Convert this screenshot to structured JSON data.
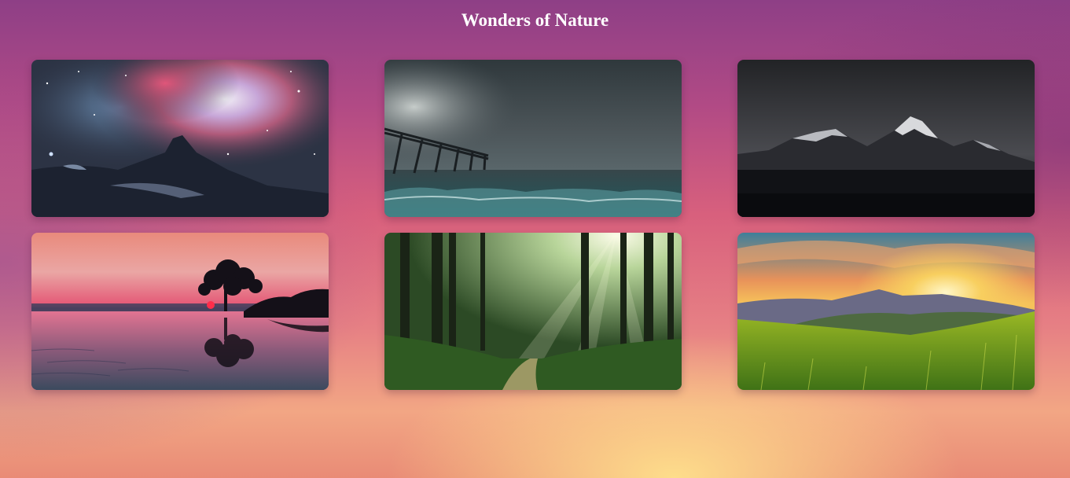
{
  "page": {
    "title": "Wonders of Nature"
  },
  "gallery": {
    "items": [
      {
        "name": "nebula-mountain-image",
        "scene": "galaxy nebula over dark mountain"
      },
      {
        "name": "stormy-pier-image",
        "scene": "pier in stormy sea"
      },
      {
        "name": "night-mountains-image",
        "scene": "snowy mountain peaks at night"
      },
      {
        "name": "sunset-tree-image",
        "scene": "tree silhouette at pink sunset over water"
      },
      {
        "name": "forest-path-image",
        "scene": "sunlit forest path"
      },
      {
        "name": "meadow-sunrise-image",
        "scene": "grassy meadow and mountains at sunrise"
      }
    ]
  },
  "colors": {
    "title_text": "#ffffff",
    "background_top": "#8e3f86",
    "background_bottom": "#f2a684"
  }
}
